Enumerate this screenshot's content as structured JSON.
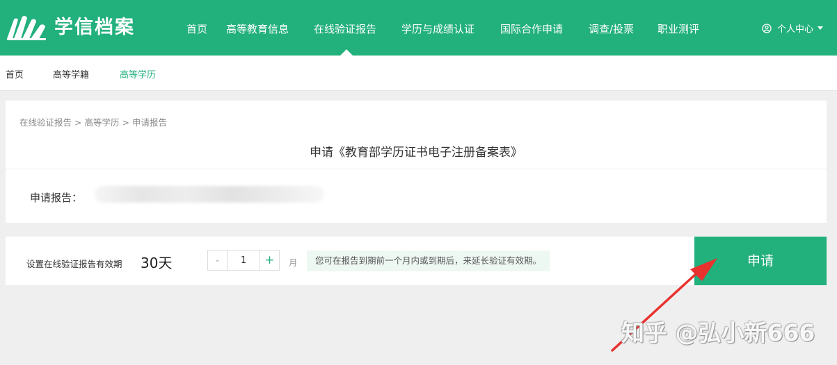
{
  "header": {
    "logo_text": "学信档案",
    "nav": [
      {
        "label": "首页"
      },
      {
        "label": "高等教育信息"
      },
      {
        "label": "在线验证报告",
        "active": true
      },
      {
        "label": "学历与成绩认证"
      },
      {
        "label": "国际合作申请"
      },
      {
        "label": "调查/投票"
      },
      {
        "label": "职业测评"
      }
    ],
    "user_menu_label": "个人中心",
    "bg_color": "#22b07d"
  },
  "subnav": [
    {
      "label": "首页"
    },
    {
      "label": "高等学籍"
    },
    {
      "label": "高等学历",
      "active": true
    }
  ],
  "breadcrumb": {
    "items": [
      "在线验证报告",
      "高等学历",
      "申请报告"
    ],
    "separator": ">"
  },
  "card": {
    "title": "申请《教育部学历证书电子注册备案表》",
    "report_label": "申请报告："
  },
  "validity": {
    "label": "设置在线验证报告有效期",
    "days": "30天",
    "stepper_minus": "-",
    "stepper_value": "1",
    "stepper_plus": "+",
    "unit": "月",
    "hint": "您可在报告到期前一个月内或到期后，来延长验证有效期。"
  },
  "apply_button": "申请",
  "watermark": "知乎 @弘小新666",
  "colors": {
    "accent": "#22b07d",
    "annotation_arrow": "#e8322e"
  }
}
